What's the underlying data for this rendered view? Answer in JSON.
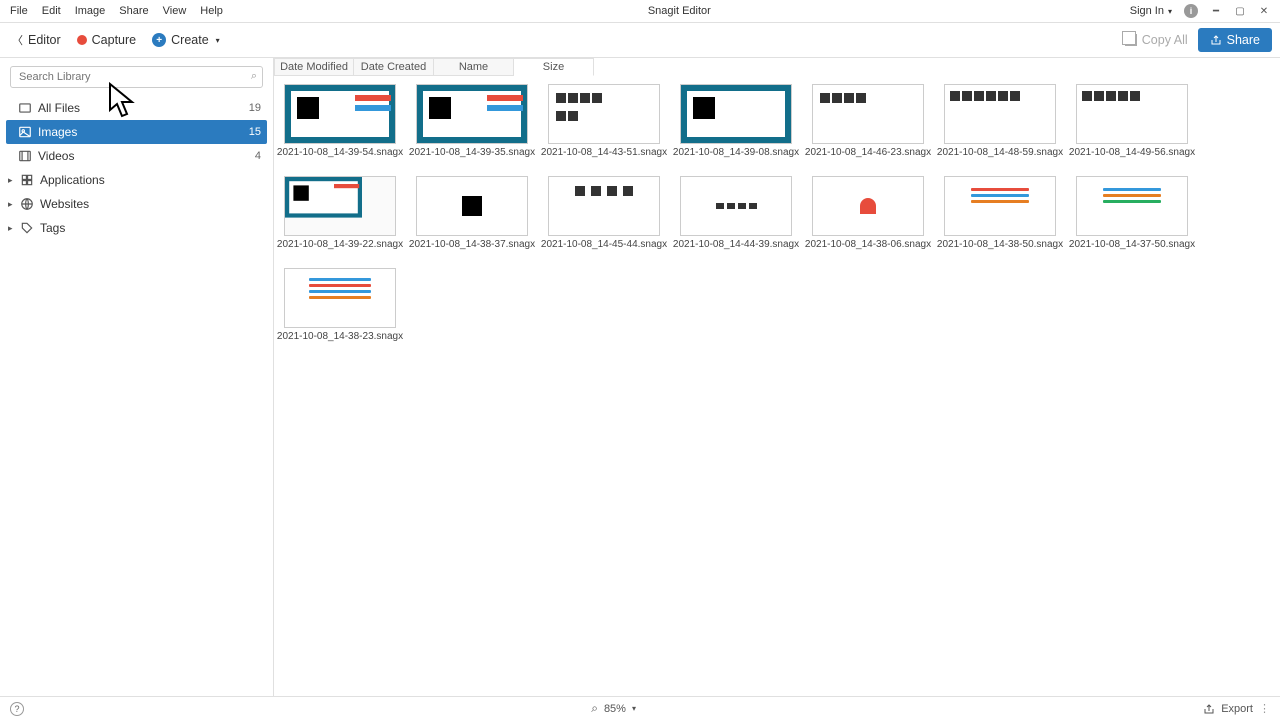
{
  "app": {
    "title": "Snagit Editor"
  },
  "menubar": {
    "file": "File",
    "edit": "Edit",
    "image": "Image",
    "share": "Share",
    "view": "View",
    "help": "Help"
  },
  "window": {
    "signin": "Sign In"
  },
  "toolbar": {
    "editor": "Editor",
    "capture": "Capture",
    "create": "Create",
    "copy_all": "Copy All",
    "share": "Share"
  },
  "search": {
    "placeholder": "Search Library"
  },
  "sidebar": {
    "items": [
      {
        "label": "All Files",
        "count": "19"
      },
      {
        "label": "Images",
        "count": "15"
      },
      {
        "label": "Videos",
        "count": "4"
      },
      {
        "label": "Applications",
        "count": ""
      },
      {
        "label": "Websites",
        "count": ""
      },
      {
        "label": "Tags",
        "count": ""
      }
    ]
  },
  "sort_tabs": {
    "date_modified": "Date Modified",
    "date_created": "Date Created",
    "name": "Name",
    "size": "Size"
  },
  "files": [
    {
      "name": "2021-10-08_14-39-54.snagx"
    },
    {
      "name": "2021-10-08_14-39-35.snagx"
    },
    {
      "name": "2021-10-08_14-43-51.snagx"
    },
    {
      "name": "2021-10-08_14-39-08.snagx"
    },
    {
      "name": "2021-10-08_14-46-23.snagx"
    },
    {
      "name": "2021-10-08_14-48-59.snagx"
    },
    {
      "name": "2021-10-08_14-49-56.snagx"
    },
    {
      "name": "2021-10-08_14-39-22.snagx"
    },
    {
      "name": "2021-10-08_14-38-37.snagx"
    },
    {
      "name": "2021-10-08_14-45-44.snagx"
    },
    {
      "name": "2021-10-08_14-44-39.snagx"
    },
    {
      "name": "2021-10-08_14-38-06.snagx"
    },
    {
      "name": "2021-10-08_14-38-50.snagx"
    },
    {
      "name": "2021-10-08_14-37-50.snagx"
    },
    {
      "name": "2021-10-08_14-38-23.snagx"
    }
  ],
  "statusbar": {
    "zoom": "85%",
    "export": "Export"
  }
}
